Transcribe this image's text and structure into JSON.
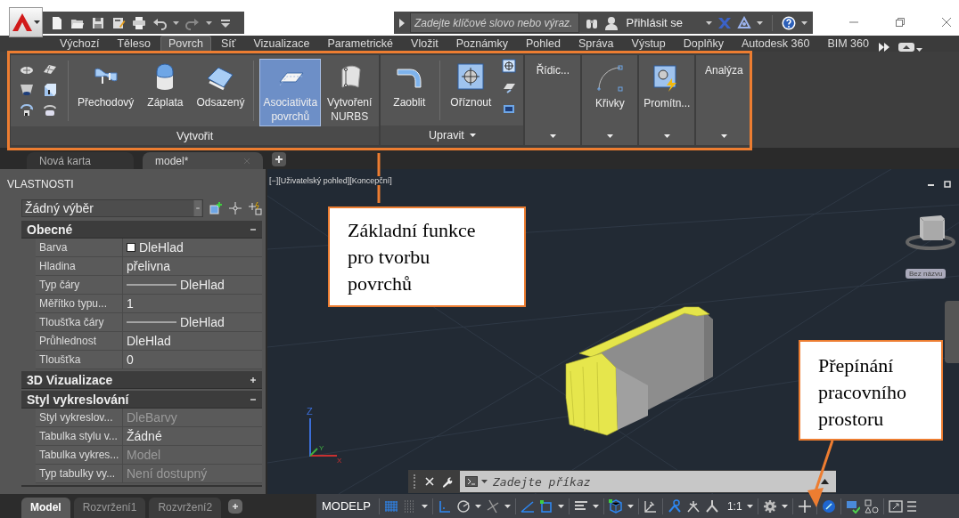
{
  "title_bar": {
    "search": {
      "placeholder": "Zadejte klíčové slovo nebo výraz."
    },
    "sign_in": "Přihlásit se"
  },
  "ribbon_tabs": [
    {
      "label": "Výchozí",
      "selected": false
    },
    {
      "label": "Těleso",
      "selected": false
    },
    {
      "label": "Povrch",
      "selected": true
    },
    {
      "label": "Síť",
      "selected": false
    },
    {
      "label": "Vizualizace",
      "selected": false
    },
    {
      "label": "Parametrické",
      "selected": false
    },
    {
      "label": "Vložit",
      "selected": false
    },
    {
      "label": "Poznámky",
      "selected": false
    },
    {
      "label": "Pohled",
      "selected": false
    },
    {
      "label": "Správa",
      "selected": false
    },
    {
      "label": "Výstup",
      "selected": false
    },
    {
      "label": "Doplňky",
      "selected": false
    },
    {
      "label": "Autodesk 360",
      "selected": false
    },
    {
      "label": "BIM 360",
      "selected": false
    }
  ],
  "ribbon_panels": [
    {
      "title": "Vytvořit",
      "dropdown": false,
      "groups": [
        {
          "tools": [
            {
              "label": "Přechodový",
              "selected": false
            },
            {
              "label": "Záplata",
              "selected": false
            },
            {
              "label": "Odsazený",
              "selected": false
            }
          ]
        },
        {
          "tools": [
            {
              "label": "Asociativita povrchů",
              "selected": true
            },
            {
              "label": "Vytvoření NURBS",
              "selected": false
            }
          ]
        }
      ]
    },
    {
      "title": "Upravit",
      "dropdown": true,
      "groups": [
        {
          "tools": [
            {
              "label": "Zaoblit",
              "selected": false
            }
          ]
        },
        {
          "tools": [
            {
              "label": "Oříznout",
              "selected": false
            }
          ]
        }
      ]
    }
  ],
  "collapsed_panels": [
    {
      "label": "Řídic..."
    },
    {
      "label": "Křivky"
    },
    {
      "label": "Promítn..."
    },
    {
      "label": "Analýza"
    }
  ],
  "document_tabs": [
    {
      "label": "Nová karta",
      "selected": false
    },
    {
      "label": "model*",
      "selected": true
    }
  ],
  "properties": {
    "title": "VLASTNOSTI",
    "selection": "Žádný výběr",
    "sections": [
      {
        "title": "Obecné",
        "expanded": true,
        "rows": [
          {
            "name": "Barva",
            "value": "DleHlad",
            "kind": "color",
            "disabled": false
          },
          {
            "name": "Hladina",
            "value": "přelivna",
            "kind": "text",
            "disabled": false
          },
          {
            "name": "Typ čáry",
            "value": "DleHlad",
            "kind": "line",
            "disabled": false
          },
          {
            "name": "Měřítko typu...",
            "value": "1",
            "kind": "text",
            "disabled": false
          },
          {
            "name": "Tloušťka čáry",
            "value": "DleHlad",
            "kind": "line",
            "disabled": false
          },
          {
            "name": "Průhlednost",
            "value": "DleHlad",
            "kind": "text",
            "disabled": false
          },
          {
            "name": "Tloušťka",
            "value": "0",
            "kind": "text",
            "disabled": false
          }
        ]
      },
      {
        "title": "3D Vizualizace",
        "expanded": false
      },
      {
        "title": "Styl vykreslování",
        "expanded": true,
        "rows": [
          {
            "name": "Styl vykreslov...",
            "value": "DleBarvy",
            "kind": "text",
            "disabled": true
          },
          {
            "name": "Tabulka stylu v...",
            "value": "Žádné",
            "kind": "text",
            "disabled": false
          },
          {
            "name": "Tabulka vykres...",
            "value": "Model",
            "kind": "text",
            "disabled": true
          },
          {
            "name": "Typ tabulky vy...",
            "value": "Není dostupný",
            "kind": "text",
            "disabled": true
          }
        ]
      }
    ]
  },
  "viewport": {
    "label": "[−][Uživatelský pohled][Koncepční]",
    "view_name": "Bez názvu",
    "ucs_labels": [
      "Z",
      "Y",
      "X"
    ],
    "command_placeholder": "Zadejte příkaz"
  },
  "layout_tabs": [
    {
      "label": "Model",
      "selected": true
    },
    {
      "label": "Rozvržení1",
      "selected": false
    },
    {
      "label": "Rozvržení2",
      "selected": false
    }
  ],
  "status_bar": {
    "space": "MODELP",
    "scale": "1:1"
  },
  "callouts": [
    {
      "text": "Základní funkce pro tvorbu povrchů"
    },
    {
      "text": "Přepínání pracovního prostoru"
    }
  ]
}
